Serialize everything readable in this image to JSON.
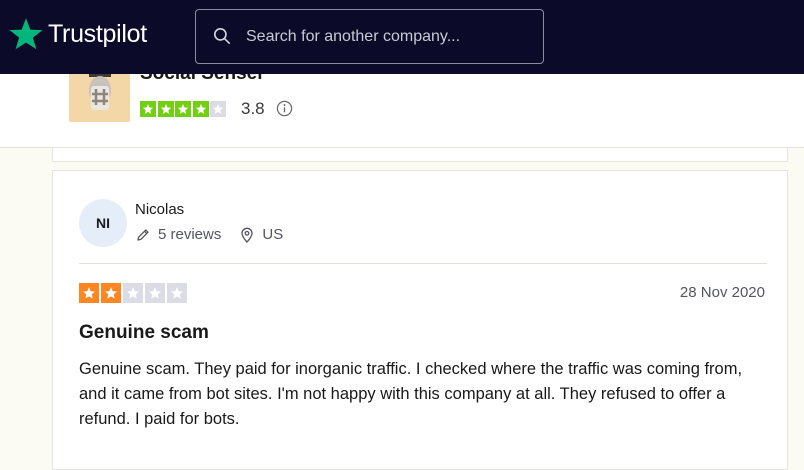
{
  "header": {
    "brand": "Trustpilot",
    "brand_icon": "star-logo-icon",
    "search_placeholder": "Search for another company...",
    "colors": {
      "background": "#0b0b29",
      "brand_star": "#00b67a"
    }
  },
  "company": {
    "name": "Social Senser",
    "trust_score": "3.8",
    "star_rating": 4,
    "star_max": 5,
    "star_color": "#73cf11"
  },
  "review": {
    "reviewer_initials": "NI",
    "reviewer_name": "Nicolas",
    "review_count": "5 reviews",
    "country": "US",
    "rating": 2,
    "rating_max": 5,
    "rating_color": "#ff8622",
    "date": "28 Nov 2020",
    "title": "Genuine scam",
    "body": "Genuine scam. They paid for inorganic traffic. I checked where the traffic was coming from, and it came from bot sites. I'm not happy with this company at all. They refused to offer a refund. I paid for bots."
  }
}
